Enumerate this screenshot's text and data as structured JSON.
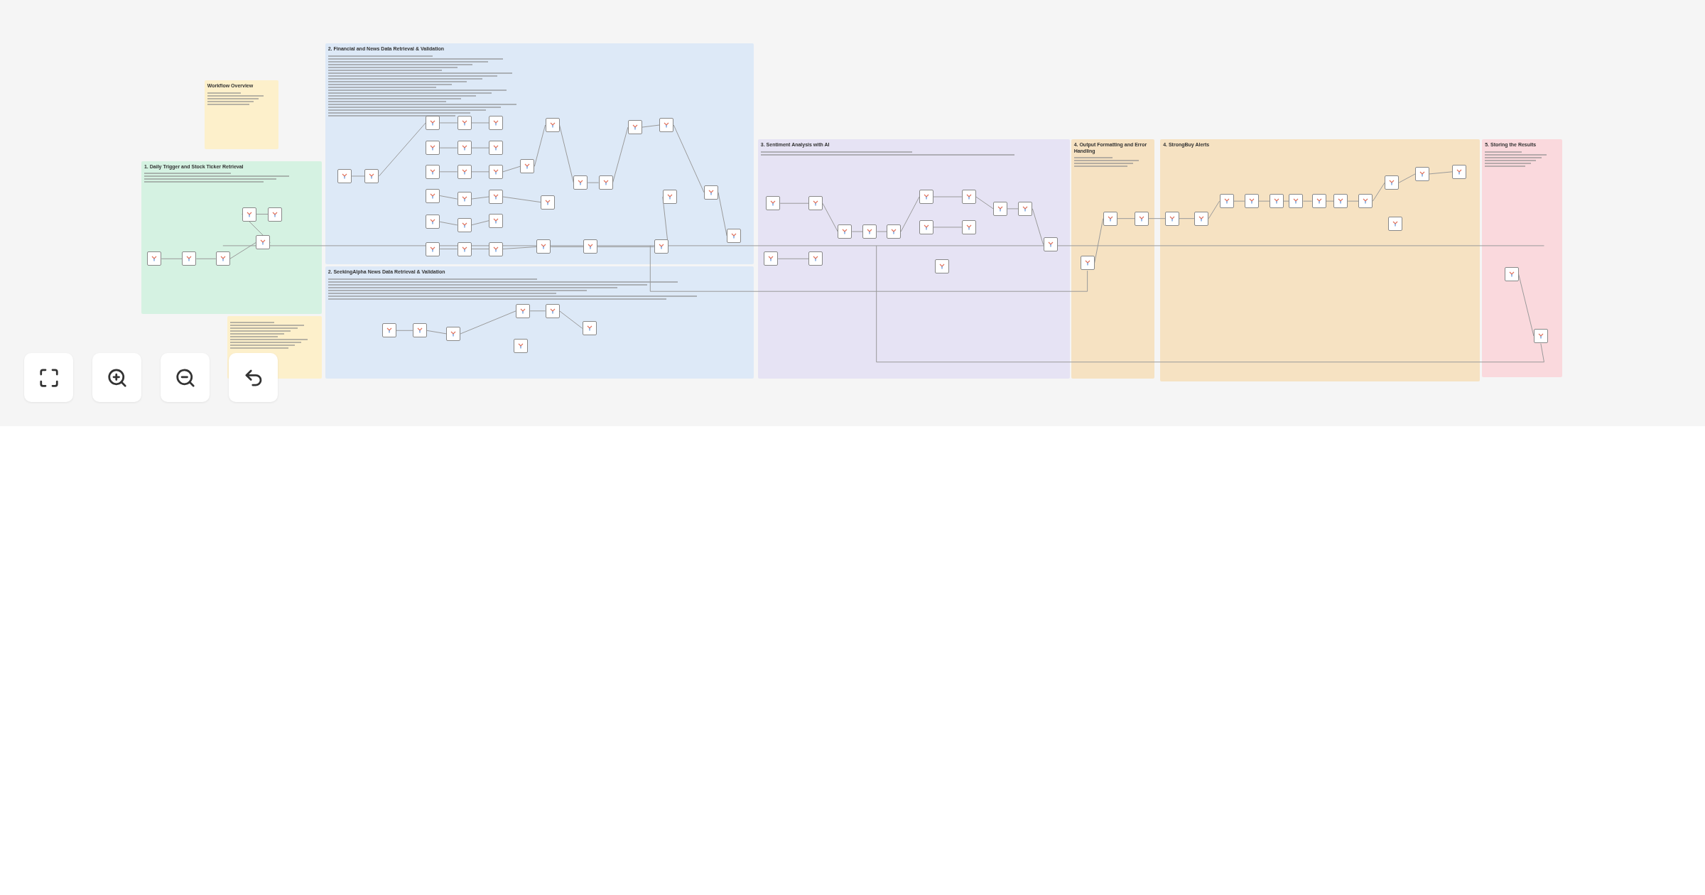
{
  "canvas": {
    "notes": [
      {
        "title": "Workflow Overview",
        "color": "#fdf0cb"
      },
      {
        "title": "1. Daily Trigger and Stock Ticker Retrieval",
        "color": "#d5f2e2"
      },
      {
        "title": "2. Financial and News Data Retrieval & Validation",
        "color": "#dde9f7"
      },
      {
        "title": "2. SeekingAlpha News Data Retrieval & Validation",
        "color": "#dde9f7"
      },
      {
        "title": "3. Sentiment Analysis with AI",
        "color": "#e6e3f4"
      },
      {
        "title": "4. Output Formatting and Error Handling",
        "color": "#f6e2c2"
      },
      {
        "title": "4. StrongBuy Alerts",
        "color": "#f6e2c2"
      },
      {
        "title": "5. Storing the Results",
        "color": "#fad9dd"
      },
      {
        "color": "#fdf0cb"
      }
    ]
  },
  "toolbar": [
    {
      "kind": "fit"
    },
    {
      "kind": "zoom_in"
    },
    {
      "kind": "zoom_out"
    },
    {
      "kind": "undo"
    }
  ]
}
